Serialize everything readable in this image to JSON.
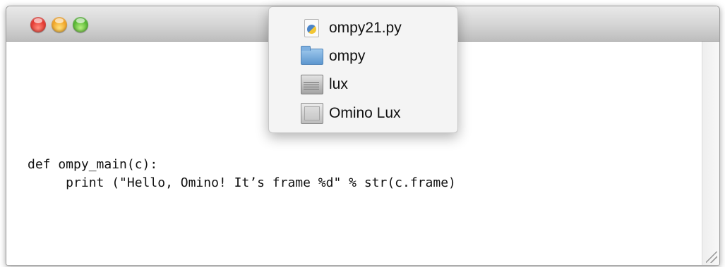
{
  "window": {
    "traffic_lights": [
      {
        "name": "close-button",
        "color": "#e2302a"
      },
      {
        "name": "minimize-button",
        "color": "#f0a020"
      },
      {
        "name": "zoom-button",
        "color": "#4fb22e"
      }
    ]
  },
  "path_menu": {
    "items": [
      {
        "label": "ompy21.py",
        "icon": "python-file-icon"
      },
      {
        "label": "ompy",
        "icon": "folder-icon"
      },
      {
        "label": "lux",
        "icon": "hard-disk-icon"
      },
      {
        "label": "Omino Lux",
        "icon": "computer-icon"
      }
    ]
  },
  "editor": {
    "lines": [
      "def ompy_main(c):",
      "     print (\"Hello, Omino! It’s frame %d\" % str(c.frame)"
    ]
  }
}
